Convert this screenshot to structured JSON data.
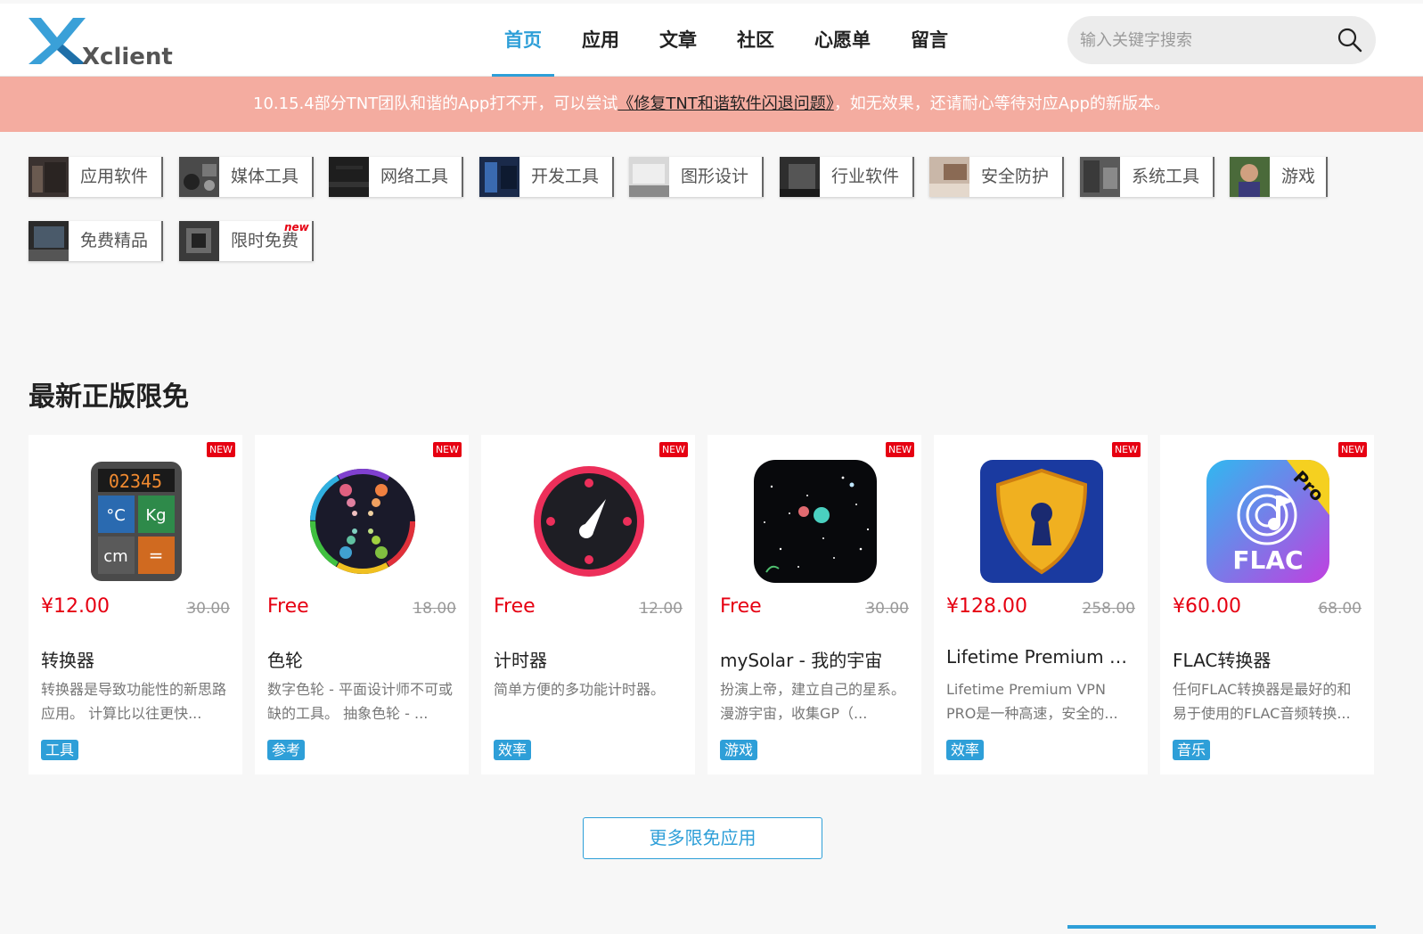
{
  "header": {
    "logo_text": "Xclient",
    "nav": [
      {
        "label": "首页",
        "active": true
      },
      {
        "label": "应用",
        "active": false
      },
      {
        "label": "文章",
        "active": false
      },
      {
        "label": "社区",
        "active": false
      },
      {
        "label": "心愿单",
        "active": false
      },
      {
        "label": "留言",
        "active": false
      }
    ],
    "search_placeholder": "输入关键字搜索"
  },
  "notice": {
    "text_before": "10.15.4部分TNT团队和谐的App打不开，可以尝试",
    "link": "《修复TNT和谐软件闪退问题》",
    "text_after": "，如无效果，还请耐心等待对应App的新版本。"
  },
  "categories": [
    {
      "label": "应用软件"
    },
    {
      "label": "媒体工具"
    },
    {
      "label": "网络工具"
    },
    {
      "label": "开发工具"
    },
    {
      "label": "图形设计"
    },
    {
      "label": "行业软件"
    },
    {
      "label": "安全防护"
    },
    {
      "label": "系统工具"
    },
    {
      "label": "游戏"
    },
    {
      "label": "免费精品"
    },
    {
      "label": "限时免费",
      "new": "new"
    }
  ],
  "section": {
    "title": "最新正版限免",
    "apps": [
      {
        "badge": "NEW",
        "price": "¥12.00",
        "old_price": "30.00",
        "name": "转换器",
        "desc": "转换器是导致功能性的新思路应用。 计算比以往更快...",
        "tag": "工具"
      },
      {
        "badge": "NEW",
        "price": "Free",
        "old_price": "18.00",
        "name": "色轮",
        "desc": "数字色轮 - 平面设计师不可或缺的工具。 抽象色轮 - ...",
        "tag": "参考"
      },
      {
        "badge": "NEW",
        "price": "Free",
        "old_price": "12.00",
        "name": "计时器",
        "desc": "简单方便的多功能计时器。",
        "tag": "效率"
      },
      {
        "badge": "NEW",
        "price": "Free",
        "old_price": "30.00",
        "name": "mySolar - 我的宇宙",
        "desc": "扮演上帝，建立自己的星系。 漫游宇宙，收集GP（...",
        "tag": "游戏"
      },
      {
        "badge": "NEW",
        "price": "¥128.00",
        "old_price": "258.00",
        "name": "Lifetime Premium VP...",
        "desc": "Lifetime Premium VPN PRO是一种高速，安全的...",
        "tag": "效率"
      },
      {
        "badge": "NEW",
        "price": "¥60.00",
        "old_price": "68.00",
        "name": "FLAC转换器",
        "desc": "任何FLAC转换器是最好的和易于使用的FLAC音频转换...",
        "tag": "音乐"
      }
    ],
    "icon_texts": {
      "converter_display": "02345",
      "converter_keys": [
        "°C",
        "Kg",
        "cm",
        "="
      ],
      "flac_text": "FLAC",
      "flac_ribbon": "Pro"
    },
    "more_label": "更多限免应用"
  },
  "colors": {
    "accent": "#2e9fd8",
    "notice_bg": "#f4aca0",
    "price_red": "#e60012"
  }
}
